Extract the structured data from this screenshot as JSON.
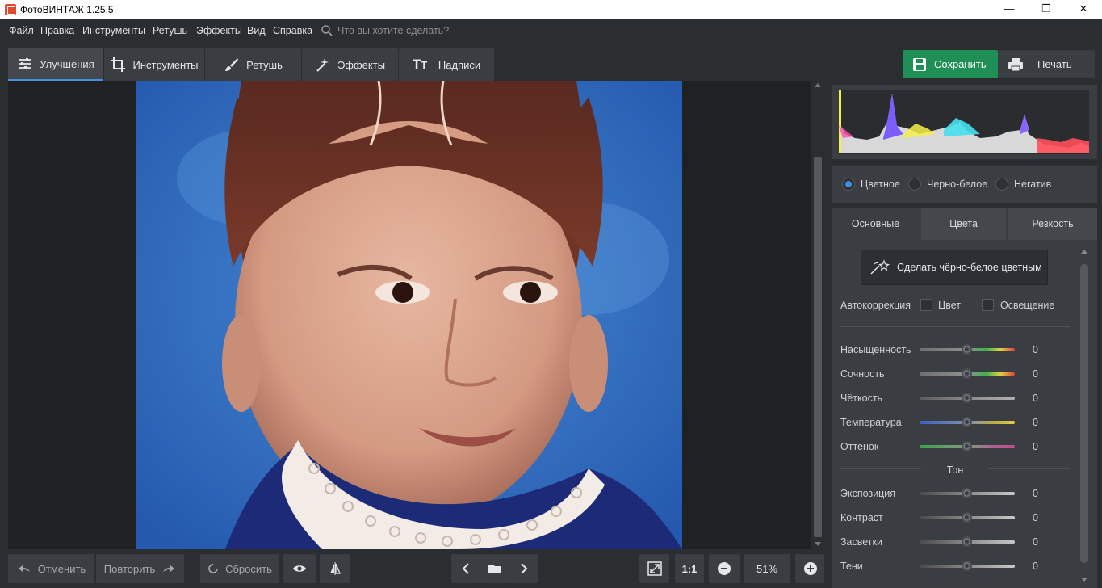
{
  "window": {
    "title": "ФотоВИНТАЖ 1.25.5",
    "minimize": "—",
    "maximize": "❐",
    "close": "✕"
  },
  "menu": {
    "items": [
      "Файл",
      "Правка",
      "Инструменты",
      "Ретушь",
      "Эффекты",
      "Вид",
      "Справка"
    ],
    "search_placeholder": "Что вы хотите сделать?"
  },
  "tabs": [
    {
      "label": "Улучшения",
      "active": true
    },
    {
      "label": "Инструменты",
      "active": false
    },
    {
      "label": "Ретушь",
      "active": false
    },
    {
      "label": "Эффекты",
      "active": false
    },
    {
      "label": "Надписи",
      "active": false
    }
  ],
  "actions": {
    "save": "Сохранить",
    "print": "Печать"
  },
  "colors": {
    "accent": "#4a8fd7",
    "save": "#1f8f55"
  },
  "color_modes": {
    "options": [
      "Цветное",
      "Черно-белое",
      "Негатив"
    ],
    "selected": "Цветное"
  },
  "settings_tabs": [
    {
      "label": "Основные",
      "active": true
    },
    {
      "label": "Цвета",
      "active": false
    },
    {
      "label": "Резкость",
      "active": false
    }
  ],
  "colorize_button": "Сделать чёрно-белое цветным",
  "autocorrect": {
    "label": "Автокоррекция",
    "options": [
      "Цвет",
      "Освещение"
    ]
  },
  "sliders": [
    {
      "label": "Насыщенность",
      "value": "0"
    },
    {
      "label": "Сочность",
      "value": "0"
    },
    {
      "label": "Чёткость",
      "value": "0"
    },
    {
      "label": "Температура",
      "value": "0"
    },
    {
      "label": "Оттенок",
      "value": "0"
    }
  ],
  "tone": {
    "title": "Тон",
    "sliders": [
      {
        "label": "Экспозиция",
        "value": "0"
      },
      {
        "label": "Контраст",
        "value": "0"
      },
      {
        "label": "Засветки",
        "value": "0"
      },
      {
        "label": "Тени",
        "value": "0"
      }
    ]
  },
  "bottom": {
    "undo": "Отменить",
    "redo": "Повторить",
    "reset": "Сбросить",
    "zoom_one": "1:1",
    "zoom_level": "51%"
  }
}
